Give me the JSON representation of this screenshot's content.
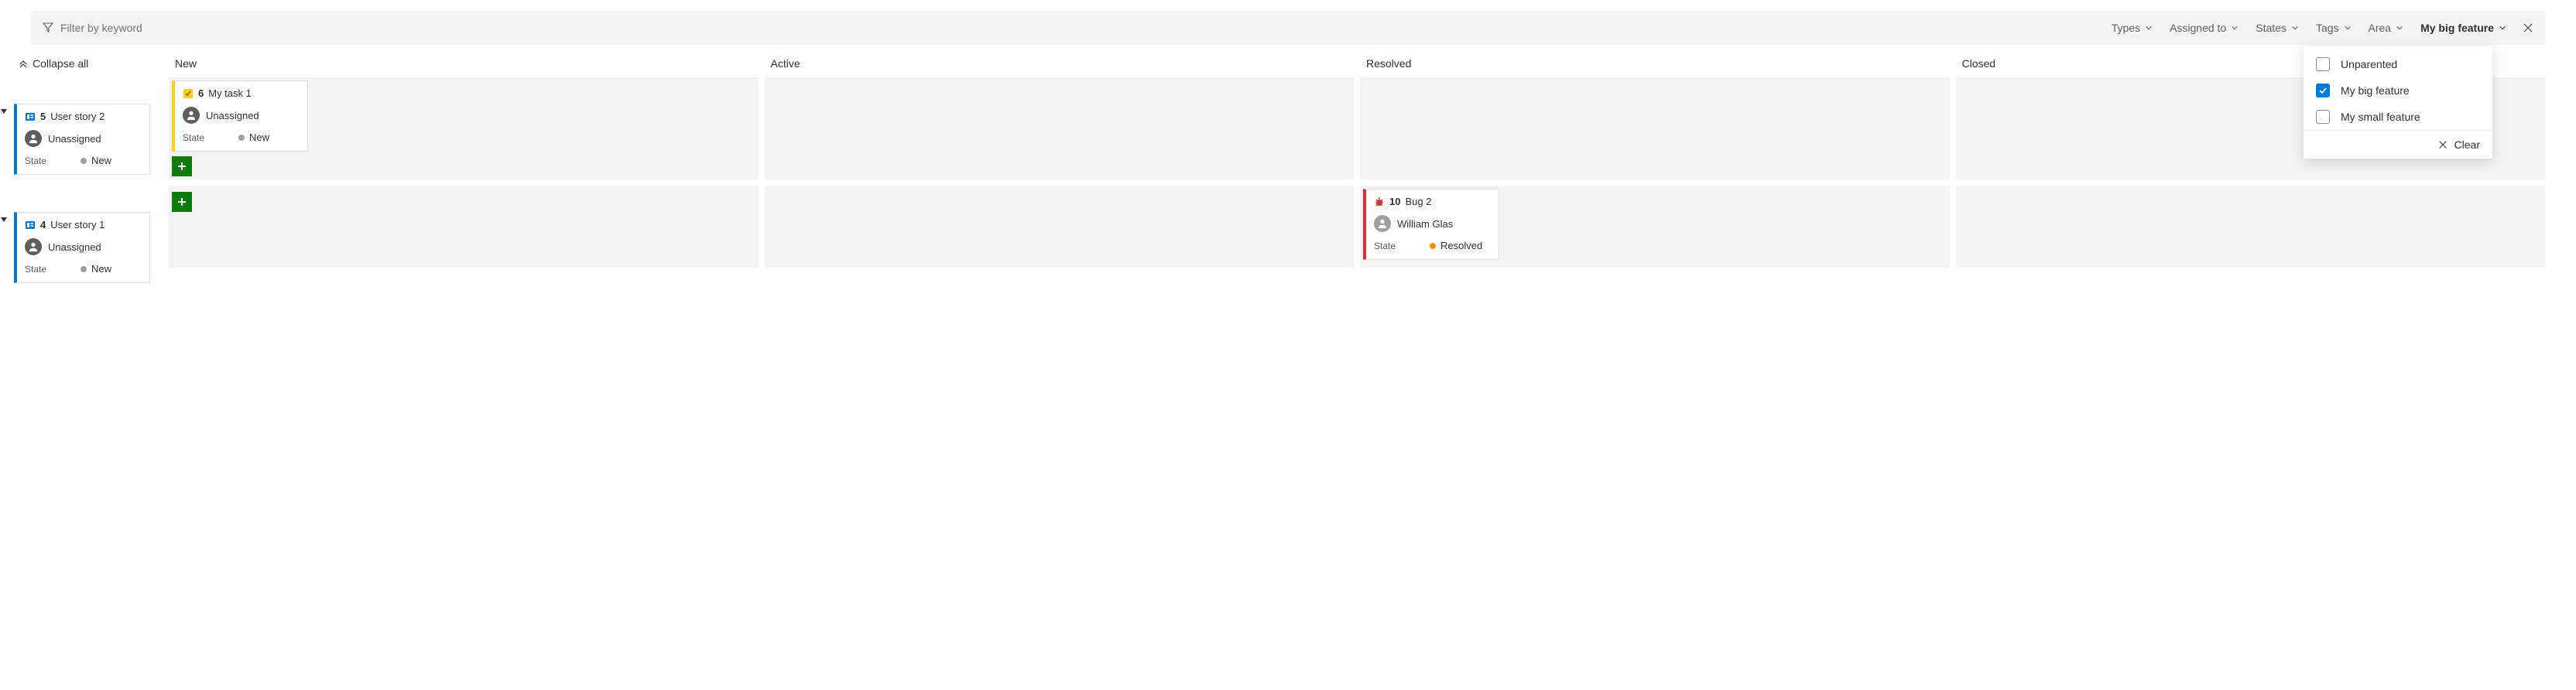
{
  "filter": {
    "placeholder": "Filter by keyword",
    "dropdowns": [
      {
        "label": "Types",
        "active": false
      },
      {
        "label": "Assigned to",
        "active": false
      },
      {
        "label": "States",
        "active": false
      },
      {
        "label": "Tags",
        "active": false
      },
      {
        "label": "Area",
        "active": false
      },
      {
        "label": "My big feature",
        "active": true
      }
    ],
    "panel": {
      "options": [
        {
          "label": "Unparented",
          "checked": false
        },
        {
          "label": "My big feature",
          "checked": true
        },
        {
          "label": "My small feature",
          "checked": false
        }
      ],
      "clear_label": "Clear"
    }
  },
  "collapse_all_label": "Collapse all",
  "columns": [
    "New",
    "Active",
    "Resolved",
    "Closed"
  ],
  "rows": [
    {
      "header_card": {
        "type": "userstory",
        "id": "5",
        "title": "User story 2",
        "assignee": "Unassigned",
        "state_label": "State",
        "state_value": "New",
        "state_color": "grey",
        "stripe": "blue"
      },
      "cells": [
        [
          {
            "type": "task",
            "id": "6",
            "title": "My task 1",
            "assignee": "Unassigned",
            "state_label": "State",
            "state_value": "New",
            "state_color": "grey",
            "stripe": "yellow"
          }
        ],
        [],
        [],
        []
      ]
    },
    {
      "header_card": {
        "type": "userstory",
        "id": "4",
        "title": "User story 1",
        "assignee": "Unassigned",
        "state_label": "State",
        "state_value": "New",
        "state_color": "grey",
        "stripe": "blue"
      },
      "cells": [
        [],
        [],
        [
          {
            "type": "bug",
            "id": "10",
            "title": "Bug 2",
            "assignee": "William Glas",
            "state_label": "State",
            "state_value": "Resolved",
            "state_color": "orange",
            "stripe": "red"
          }
        ],
        []
      ]
    }
  ]
}
